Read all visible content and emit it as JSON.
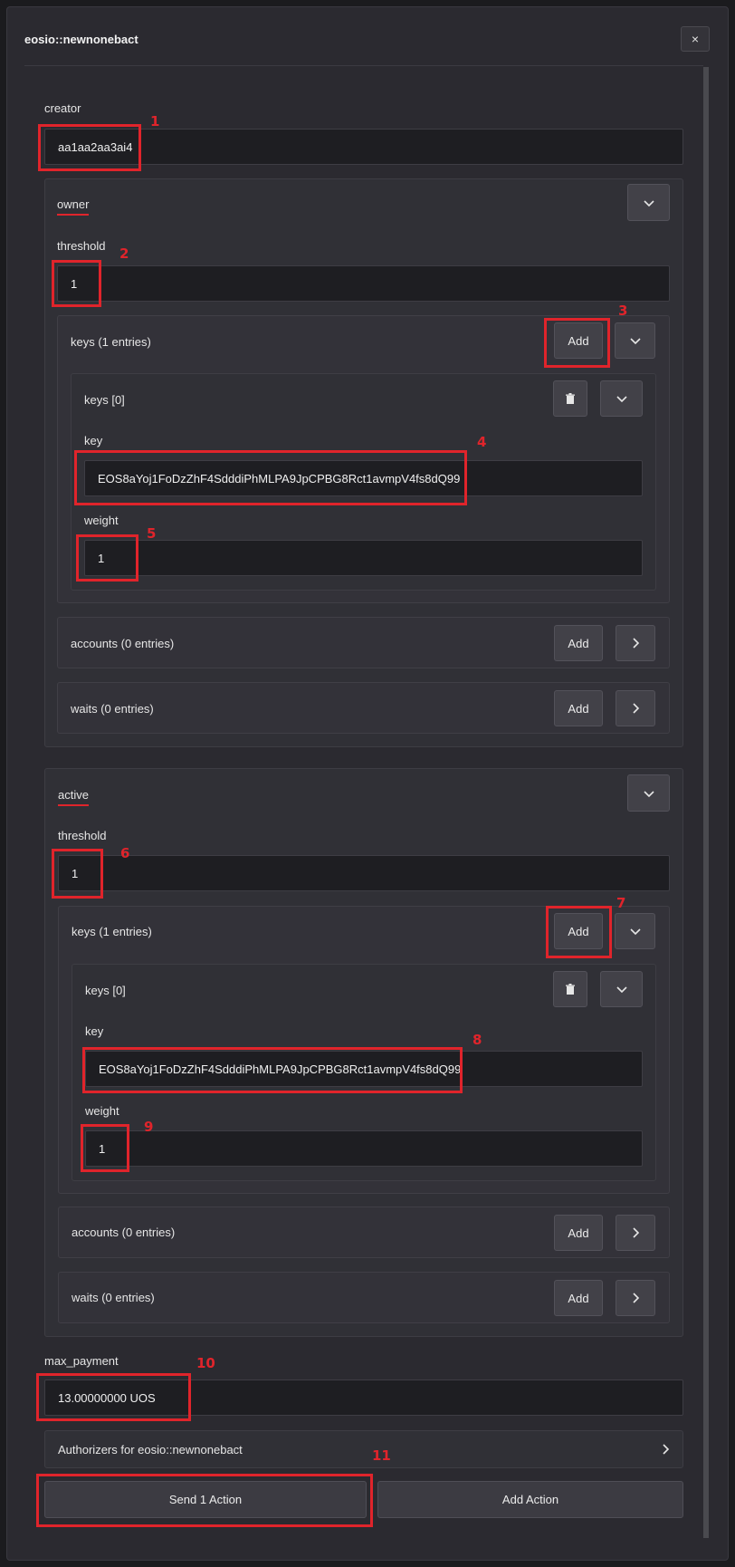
{
  "modal": {
    "title": "eosio::newnonebact",
    "close_icon": "×"
  },
  "creator": {
    "label": "creator",
    "value": "aa1aa2aa3ai4"
  },
  "owner": {
    "title": "owner",
    "threshold_label": "threshold",
    "threshold_value": "1",
    "keys_label": "keys (1 entries)",
    "key_item_label": "keys [0]",
    "key_label": "key",
    "key_value": "EOS8aYoj1FoDzZhF4SdddiPhMLPA9JpCPBG8Rct1avmpV4fs8dQ99",
    "weight_label": "weight",
    "weight_value": "1",
    "accounts_label": "accounts (0 entries)",
    "waits_label": "waits (0 entries)"
  },
  "active": {
    "title": "active",
    "threshold_label": "threshold",
    "threshold_value": "1",
    "keys_label": "keys (1 entries)",
    "key_item_label": "keys [0]",
    "key_label": "key",
    "key_value": "EOS8aYoj1FoDzZhF4SdddiPhMLPA9JpCPBG8Rct1avmpV4fs8dQ99",
    "weight_label": "weight",
    "weight_value": "1",
    "accounts_label": "accounts (0 entries)",
    "waits_label": "waits (0 entries)"
  },
  "buttons": {
    "add": "Add",
    "send": "Send 1 Action",
    "add_action": "Add Action"
  },
  "max_payment": {
    "label": "max_payment",
    "value": "13.00000000 UOS"
  },
  "authorizers": {
    "label": "Authorizers for eosio::newnonebact"
  },
  "markers": [
    "1",
    "2",
    "3",
    "4",
    "5",
    "6",
    "7",
    "8",
    "9",
    "10",
    "11"
  ],
  "colors": {
    "highlight": "#e0242b",
    "background": "#2b2a30",
    "field": "#1e1e22"
  }
}
